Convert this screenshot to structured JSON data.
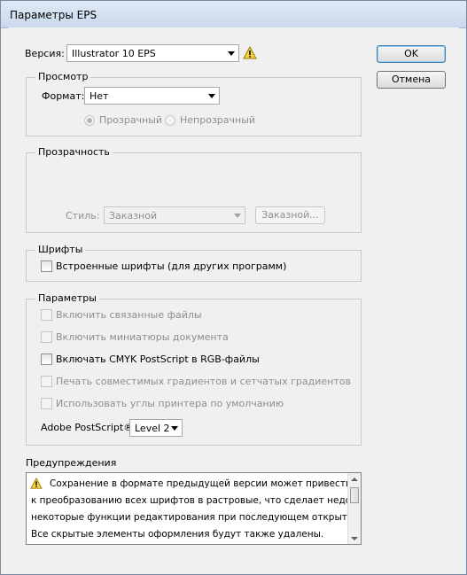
{
  "window": {
    "title": "Параметры EPS"
  },
  "version": {
    "label": "Версия:",
    "value": "Illustrator 10 EPS",
    "icon": "warning-icon"
  },
  "buttons": {
    "ok": "OK",
    "cancel": "Отмена"
  },
  "preview": {
    "group_label": "Просмотр",
    "format_label": "Формат:",
    "format_value": "Нет",
    "transparent": "Прозрачный",
    "opaque": "Непрозрачный"
  },
  "transparency": {
    "group_label": "Прозрачность",
    "style_label": "Стиль:",
    "style_value": "Заказной",
    "custom_button": "Заказной..."
  },
  "fonts": {
    "group_label": "Шрифты",
    "embed": "Встроенные шрифты (для других программ)"
  },
  "options": {
    "group_label": "Параметры",
    "linked": "Включить связанные файлы",
    "thumbnails": "Включить миниатюры документа",
    "cmyk": "Включать CMYK PostScript в RGB-файлы",
    "gradients": "Печать совместимых градиентов и сетчатых градиентов",
    "printer": "Использовать углы принтера по умолчанию",
    "postscript_label": "Adobe PostScript®:",
    "postscript_value": "Level 2"
  },
  "warnings": {
    "label": "Предупреждения",
    "lines": [
      "Сохранение в формате предыдущей версии может привести",
      "к преобразованию всех шрифтов в растровые, что сделает недоступн...",
      "некоторые функции редактирования при последующем открытии до...",
      "Все скрытые элементы оформления будут также удалены."
    ]
  }
}
